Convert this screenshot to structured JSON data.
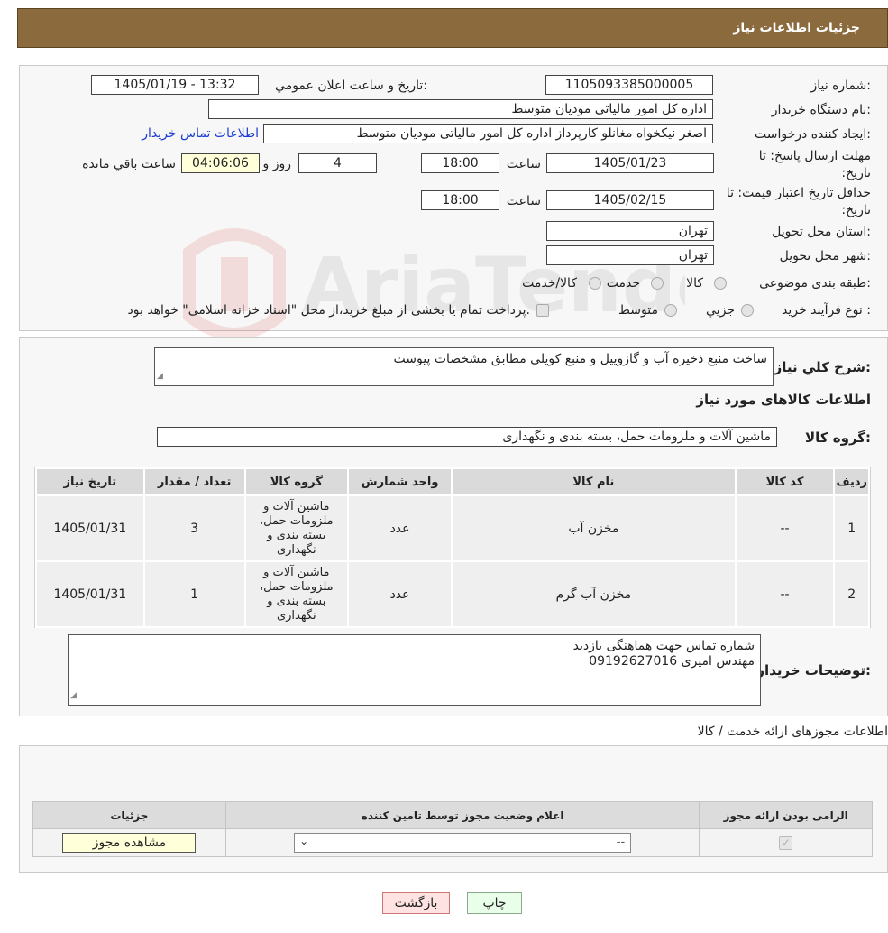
{
  "header": {
    "title": "جزئیات اطلاعات نیاز"
  },
  "watermark": "AriaTender.neT",
  "details": {
    "need_number_label": "شماره نیاز:",
    "need_number": "1105093385000005",
    "announce_label": "تاریخ و ساعت اعلان عمومي:",
    "announce_value": "1405/01/19 - 13:32",
    "buyer_label": "نام دستگاه خریدار:",
    "buyer_value": "اداره كل امور مالياتی موديان متوسط",
    "creator_label": "ایجاد کننده درخواست:",
    "creator_value": "اصغر نیکخواه مغانلو کارپرداز اداره كل امور مالياتی موديان متوسط",
    "contact_link": "اطلاعات تماس خریدار",
    "deadline_label": "مهلت ارسال پاسخ: تا تاریخ:",
    "deadline_date": "1405/01/23",
    "time_label": "ساعت",
    "deadline_time": "18:00",
    "days_value": "4",
    "days_label": "روز و",
    "remaining_time": "04:06:06",
    "remaining_label": "ساعت باقي مانده",
    "validity_label": "حداقل تاریخ اعتبار قیمت: تا تاریخ:",
    "validity_date": "1405/02/15",
    "validity_time": "18:00",
    "province_label": "استان محل تحویل:",
    "province_value": "تهران",
    "city_label": "شهر محل تحویل:",
    "city_value": "تهران",
    "category_label": "طبقه بندی موضوعی:",
    "category_options": [
      "کالا",
      "خدمت",
      "کالا/خدمت"
    ],
    "process_label": "نوع فرآیند خرید :",
    "process_options": [
      "جزيي",
      "متوسط"
    ],
    "payment_note": "پرداخت تمام یا بخشی از مبلغ خرید،از محل \"اسناد خزانه اسلامی\" خواهد بود."
  },
  "need": {
    "summary_label": "شرح کلي نیاز:",
    "summary_value": "ساخت منبع ذخیره آب و گازوییل و منبع کویلی مطابق مشخصات پیوست",
    "goods_info_title": "اطلاعات کالاهای مورد نیاز",
    "group_label": "گروه کالا:",
    "group_value": "ماشین آلات و ملزومات حمل، بسته بندی و نگهداری"
  },
  "items_table": {
    "headers": [
      "ردیف",
      "کد کالا",
      "نام کالا",
      "واحد شمارش",
      "گروه کالا",
      "تعداد / مقدار",
      "تاریخ نیاز"
    ],
    "rows": [
      {
        "row": "1",
        "code": "--",
        "name": "مخزن آب",
        "unit": "عدد",
        "group": "ماشین آلات و ملزومات حمل، بسته بندی و نگهداری",
        "qty": "3",
        "date": "1405/01/31"
      },
      {
        "row": "2",
        "code": "--",
        "name": "مخزن آب گرم",
        "unit": "عدد",
        "group": "ماشین آلات و ملزومات حمل، بسته بندی و نگهداری",
        "qty": "1",
        "date": "1405/01/31"
      }
    ]
  },
  "buyer_notes": {
    "label": "توضیحات خریدار:",
    "line1": "شماره تماس جهت هماهنگی بازدید",
    "line2": "مهندس امیری 09192627016"
  },
  "licenses": {
    "section_title": "اطلاعات مجوزهای ارائه خدمت / کالا",
    "headers": [
      "الزامی بودن ارائه مجوز",
      "اعلام وضعیت مجوز توسط تامین کننده",
      "جزئیات"
    ],
    "select_value": "--",
    "view_button": "مشاهده مجوز"
  },
  "footer": {
    "print_button": "چاپ",
    "back_button": "بازگشت"
  },
  "colors": {
    "header_bg": "#8b6a3e",
    "link": "#1a3dd1",
    "back_bg": "#ffe2e2",
    "print_bg": "#eaffea"
  }
}
